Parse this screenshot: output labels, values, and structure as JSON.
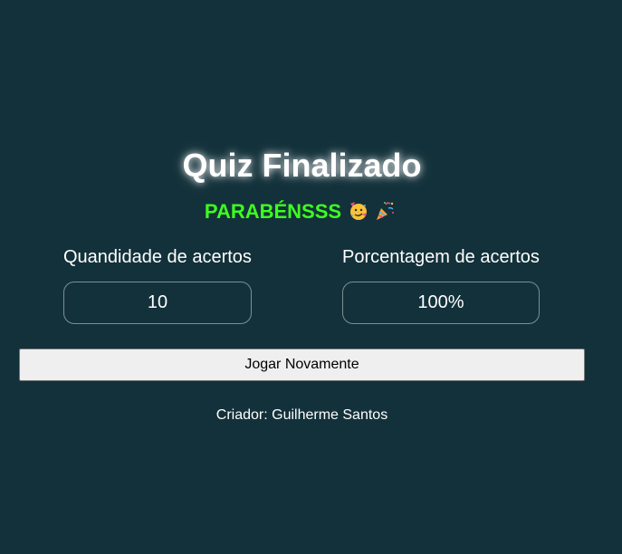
{
  "quiz": {
    "title": "Quiz Finalizado",
    "congrats": "PARABÉNSSS",
    "congrats_icons": [
      "partying-face-icon",
      "party-popper-icon"
    ]
  },
  "stats": {
    "correct_label": "Quandidade de acertos",
    "correct_value": "10",
    "percent_label": "Porcentagem de acertos",
    "percent_value": "100%"
  },
  "actions": {
    "play_again_label": "Jogar Novamente"
  },
  "footer": {
    "creator": "Criador: Guilherme Santos"
  },
  "colors": {
    "background": "#13313a",
    "congrats": "#3dff1f",
    "button_bg": "#efefef"
  }
}
